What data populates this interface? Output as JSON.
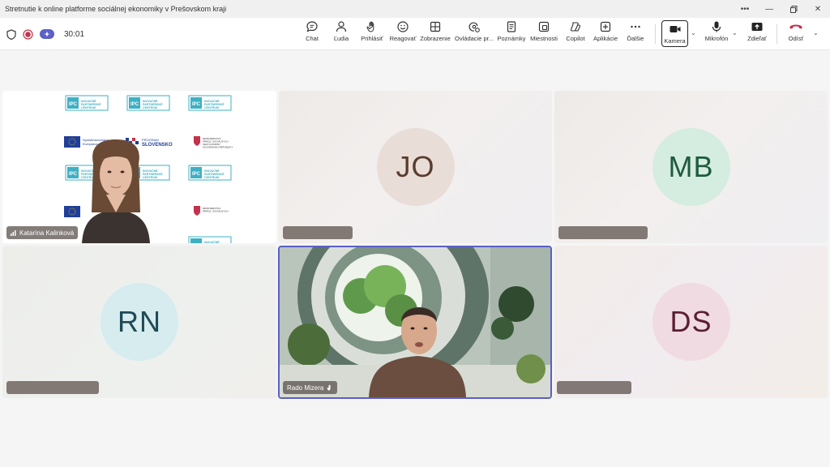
{
  "window": {
    "title": "Stretnutie k online platforme sociálnej ekonomiky v Prešovskom kraji",
    "controls": [
      "more-icon",
      "minimize-icon",
      "restore-icon",
      "close-icon"
    ]
  },
  "toolbar": {
    "timer": "30:01",
    "buttons": [
      {
        "id": "chat",
        "label": "Chat",
        "icon": "chat-icon"
      },
      {
        "id": "people",
        "label": "Ľudia",
        "icon": "people-icon"
      },
      {
        "id": "raise",
        "label": "Prihlásiť",
        "icon": "hand-icon"
      },
      {
        "id": "react",
        "label": "Reagovať",
        "icon": "smile-icon"
      },
      {
        "id": "view",
        "label": "Zobrazenie",
        "icon": "grid-icon"
      },
      {
        "id": "controls",
        "label": "Ovládacie pr...",
        "icon": "controls-icon"
      },
      {
        "id": "notes",
        "label": "Poznámky",
        "icon": "notes-icon"
      },
      {
        "id": "rooms",
        "label": "Miestnosti",
        "icon": "rooms-icon"
      },
      {
        "id": "copilot",
        "label": "Copilot",
        "icon": "copilot-icon"
      },
      {
        "id": "apps",
        "label": "Aplikácie",
        "icon": "plus-icon"
      },
      {
        "id": "more",
        "label": "Ďalšie",
        "icon": "ellipsis-icon"
      },
      {
        "id": "camera",
        "label": "Kamera",
        "icon": "camera-icon"
      },
      {
        "id": "mic",
        "label": "Mikrofón",
        "icon": "mic-icon"
      },
      {
        "id": "share",
        "label": "Zdieľať",
        "icon": "share-icon"
      },
      {
        "id": "leave",
        "label": "Odísť",
        "icon": "hangup-icon"
      }
    ],
    "colors": {
      "leave": "#c4314b",
      "recording": "#c4314b",
      "accent": "#5b5fc7"
    }
  },
  "participants": [
    {
      "name": "Katarína Kalinková",
      "type": "video",
      "icon": "signal-icon"
    },
    {
      "initials": "JO",
      "type": "avatar",
      "avatar_bg": "#e9ddd7",
      "avatar_fg": "#5a3c2e"
    },
    {
      "initials": "MB",
      "type": "avatar",
      "avatar_bg": "#d5ece0",
      "avatar_fg": "#1e5b3c"
    },
    {
      "initials": "RN",
      "type": "avatar",
      "avatar_bg": "#d6ecef",
      "avatar_fg": "#1f4a55"
    },
    {
      "name": "Rado Mizera",
      "type": "video",
      "active": true,
      "icon": "raised-hand-icon"
    },
    {
      "initials": "DS",
      "type": "avatar",
      "avatar_bg": "#f0dbe2",
      "avatar_fg": "#5a1f33"
    }
  ],
  "backdrop": {
    "logo_text_1": "IPC",
    "logo_text_2": "INOVAČNÉ PARTNERSKÉ CENTRUM",
    "eu_text": "Spolufinancovaný Európskou úniou",
    "program_text_1": "PROGRAM",
    "program_text_2": "SLOVENSKO",
    "ministry_text": "MINISTERSTVO PRÁCE, SOCIÁLNYCH VECÍ A RODINY SLOVENSKEJ REPUBLIKY"
  }
}
